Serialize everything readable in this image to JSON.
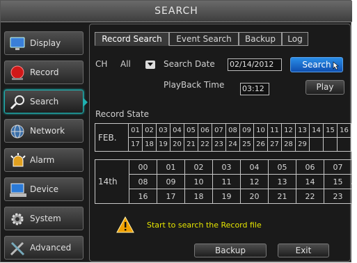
{
  "window": {
    "title": "SEARCH"
  },
  "sidebar": {
    "items": [
      {
        "label": "Display"
      },
      {
        "label": "Record"
      },
      {
        "label": "Search",
        "active": true
      },
      {
        "label": "Network"
      },
      {
        "label": "Alarm"
      },
      {
        "label": "Device"
      },
      {
        "label": "System"
      },
      {
        "label": "Advanced"
      }
    ]
  },
  "tabs": [
    {
      "label": "Record Search",
      "active": true
    },
    {
      "label": "Event Search"
    },
    {
      "label": "Backup"
    },
    {
      "label": "Log"
    }
  ],
  "form": {
    "ch_label": "CH",
    "ch_value": "All",
    "search_date_label": "Search Date",
    "search_date_value": "02/14/2012",
    "search_button": "Search",
    "playback_time_label": "PlayBack Time",
    "playback_time_value": "03:12",
    "play_button": "Play"
  },
  "record_state": {
    "title": "Record State",
    "month_label": "FEB.",
    "days_row1": [
      "01",
      "02",
      "03",
      "04",
      "05",
      "06",
      "07",
      "08",
      "09",
      "10",
      "11",
      "12",
      "13",
      "14",
      "15",
      "16"
    ],
    "days_row2": [
      "17",
      "18",
      "19",
      "20",
      "21",
      "22",
      "23",
      "24",
      "25",
      "26",
      "27",
      "28",
      "29",
      "",
      "",
      ""
    ],
    "day_label": "14th",
    "hours_row1": [
      "00",
      "01",
      "02",
      "03",
      "04",
      "05",
      "06",
      "07"
    ],
    "hours_row2": [
      "08",
      "09",
      "10",
      "11",
      "12",
      "13",
      "14",
      "15"
    ],
    "hours_row3": [
      "16",
      "17",
      "18",
      "19",
      "20",
      "21",
      "22",
      "23"
    ]
  },
  "status": {
    "message": "Start to search the Record file"
  },
  "footer": {
    "backup_button": "Backup",
    "exit_button": "Exit"
  },
  "colors": {
    "accent_blue": "#1f6fd0",
    "active_outline": "#1fb0b0",
    "warning_text": "#e6e600"
  }
}
